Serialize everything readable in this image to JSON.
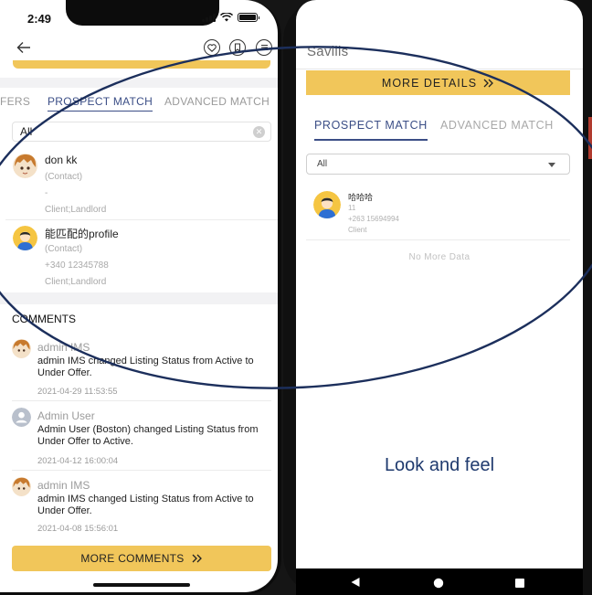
{
  "left_phone": {
    "status_bar": {
      "time": "2:49"
    },
    "tabs": [
      {
        "label": "FERS",
        "active": false
      },
      {
        "label": "PROSPECT MATCH",
        "active": true
      },
      {
        "label": "ADVANCED MATCH",
        "active": false
      }
    ],
    "filter": {
      "value": "All"
    },
    "matches": [
      {
        "name": "don kk",
        "lines": [
          "(Contact)",
          "-",
          "Client;Landlord"
        ],
        "avatar": "anime-avatar"
      },
      {
        "name": "能匹配的profile",
        "lines": [
          "(Contact)",
          "+340 12345788",
          "Client;Landlord"
        ],
        "avatar": "person-avatar"
      }
    ],
    "comments_title": "COMMENTS",
    "comments": [
      {
        "author": "admin IMS",
        "message": "admin IMS changed Listing Status from Active to Under Offer.",
        "timestamp": "2021-04-29 11:53:55",
        "avatar": "anime-avatar"
      },
      {
        "author": "Admin User",
        "message": "Admin User (Boston) changed Listing Status from Under Offer to Active.",
        "timestamp": "2021-04-12 16:00:04",
        "avatar": "default-user-avatar"
      },
      {
        "author": "admin IMS",
        "message": "admin IMS changed Listing Status from Active to Under Offer.",
        "timestamp": "2021-04-08 15:56:01",
        "avatar": "anime-avatar"
      }
    ],
    "more_comments_label": "MORE COMMENTS",
    "colors": {
      "accent": "#f1c65a",
      "tab_active": "#3b4e86"
    }
  },
  "right_phone": {
    "app_title": "Savills",
    "more_details_label": "MORE DETAILS",
    "tabs": [
      {
        "label": "PROSPECT MATCH",
        "active": true
      },
      {
        "label": "ADVANCED MATCH",
        "active": false
      }
    ],
    "filter": {
      "value": "All"
    },
    "match": {
      "name": "哈哈哈",
      "lines": [
        "11",
        "+263 15694994",
        "Client"
      ],
      "avatar": "person-avatar"
    },
    "no_more_data": "No More Data",
    "caption": "Look and feel",
    "nav_icons": [
      "back-triangle-icon",
      "home-circle-icon",
      "recents-square-icon"
    ]
  }
}
